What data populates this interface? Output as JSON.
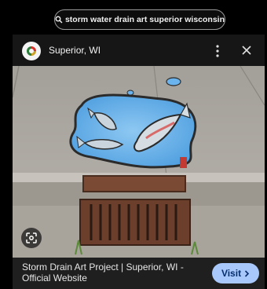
{
  "search": {
    "query": "storm water drain art superior wisconsin"
  },
  "source": {
    "name": "Superior, WI",
    "logo_icon": "city-logo-icon"
  },
  "result": {
    "title": "Storm Drain Art Project | Superior, WI - Official Website",
    "visit_label": "Visit"
  },
  "colors": {
    "accent": "#a8c7fa",
    "accent_text": "#062e6f",
    "puddle": "#5aa9e8"
  }
}
